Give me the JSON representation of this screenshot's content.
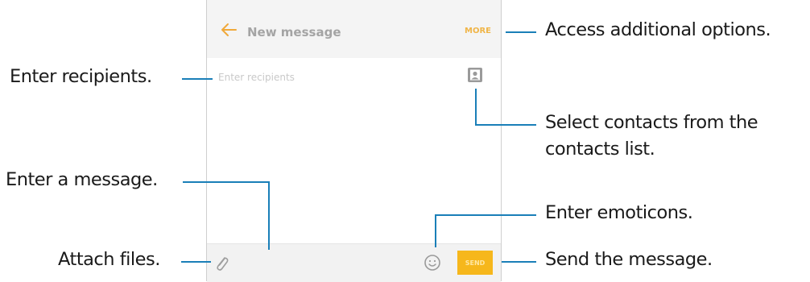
{
  "phone": {
    "title": "New message",
    "more_label": "MORE",
    "recipients_placeholder": "Enter recipients",
    "send_label": "SEND"
  },
  "callouts": {
    "access_options": "Access additional options.",
    "enter_recipients": "Enter recipients.",
    "select_contacts_line1": "Select contacts from the",
    "select_contacts_line2": "contacts list.",
    "enter_message": "Enter a message.",
    "enter_emoticons": "Enter emoticons.",
    "attach_files": "Attach files.",
    "send_message": "Send the message."
  },
  "icons": {
    "back": "back-arrow-icon",
    "contacts": "contacts-icon",
    "attach": "paperclip-icon",
    "emoticon": "smiley-icon"
  },
  "colors": {
    "accent": "#f6b71c",
    "accent_text": "#f0b548",
    "callout_line": "#1a7fb8"
  }
}
